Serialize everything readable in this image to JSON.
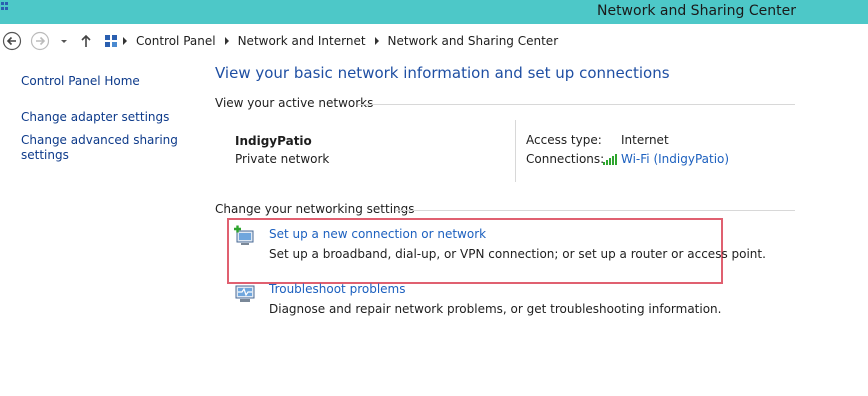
{
  "window": {
    "title": "Network and Sharing Center"
  },
  "breadcrumb": [
    "Control Panel",
    "Network and Internet",
    "Network and Sharing Center"
  ],
  "sidebar": {
    "home": "Control Panel Home",
    "adapter": "Change adapter settings",
    "advanced": "Change advanced sharing\nsettings"
  },
  "main": {
    "heading": "View your basic network information and set up connections",
    "active_networks_label": "View your active networks",
    "network": {
      "name": "IndigyPatio",
      "type": "Private network",
      "access_type_label": "Access type:",
      "access_type_value": "Internet",
      "connections_label": "Connections:",
      "connections_value": "Wi-Fi (IndigyPatio)"
    },
    "settings_label": "Change your networking settings",
    "tasks": [
      {
        "title": "Set up a new connection or network",
        "description": "Set up a broadband, dial-up, or VPN connection; or set up a router or access point."
      },
      {
        "title": "Troubleshoot problems",
        "description": "Diagnose and repair network problems, or get troubleshooting information."
      }
    ]
  },
  "colors": {
    "titlebar": "#4dc8c8",
    "link": "#1c60bf",
    "heading": "#1f4fa3",
    "highlight": "#e06070",
    "wifi_signal": "#2ea52e"
  },
  "icons": [
    "app-icon",
    "back-arrow-icon",
    "forward-arrow-icon",
    "dropdown-arrow-icon",
    "up-arrow-icon",
    "control-panel-icon",
    "chevron-right-icon",
    "wifi-signal-icon",
    "new-connection-icon",
    "troubleshoot-icon"
  ]
}
